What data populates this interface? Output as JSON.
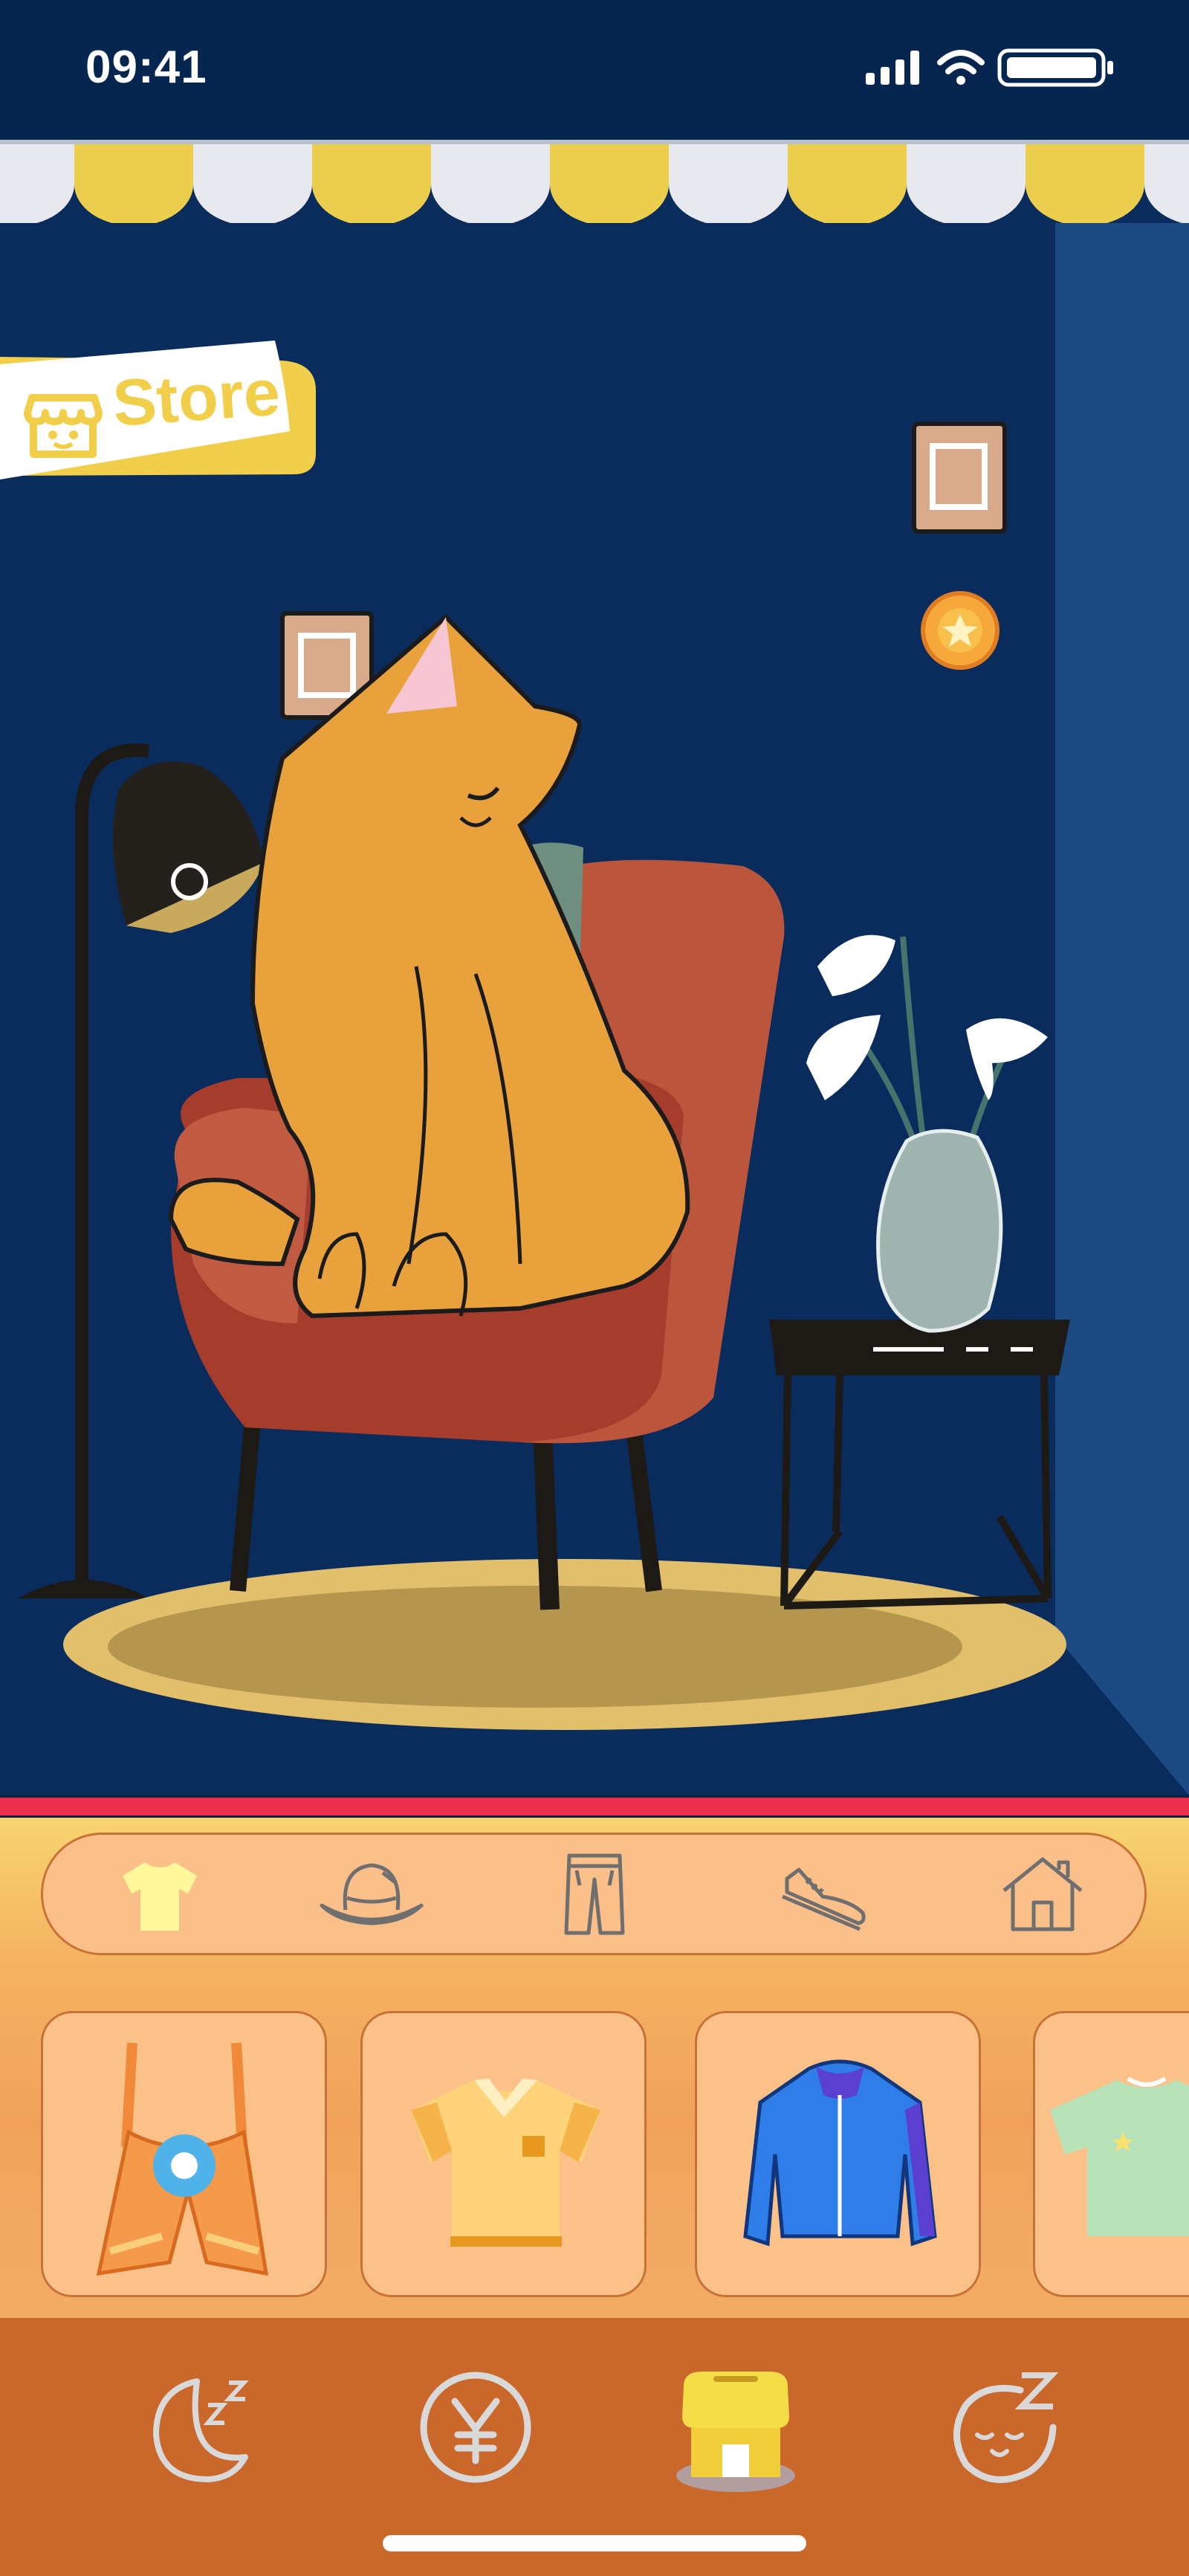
{
  "status_bar": {
    "time": "09:41"
  },
  "store": {
    "label": "Store"
  },
  "categories": [
    {
      "name": "shirts",
      "icon": "tshirt-icon",
      "active": true
    },
    {
      "name": "hats",
      "icon": "hat-icon",
      "active": false
    },
    {
      "name": "pants",
      "icon": "pants-icon",
      "active": false
    },
    {
      "name": "shoes",
      "icon": "shoe-icon",
      "active": false
    },
    {
      "name": "home",
      "icon": "house-icon",
      "active": false
    }
  ],
  "items": [
    {
      "icon": "overalls-icon"
    },
    {
      "icon": "polo-shirt-icon"
    },
    {
      "icon": "jacket-icon"
    },
    {
      "icon": "green-tshirt-icon"
    }
  ],
  "nav": [
    {
      "icon": "sleep-moon-icon",
      "active": false
    },
    {
      "icon": "yen-coin-icon",
      "active": false
    },
    {
      "icon": "store-icon",
      "active": true
    },
    {
      "icon": "sleepy-face-icon",
      "active": false
    }
  ],
  "colors": {
    "background": "#0a2c5d",
    "accent_yellow": "#f2cf4a",
    "panel_orange": "#f0a25a",
    "nav_orange": "#c9682a",
    "divider_red": "#ec2f4d"
  }
}
